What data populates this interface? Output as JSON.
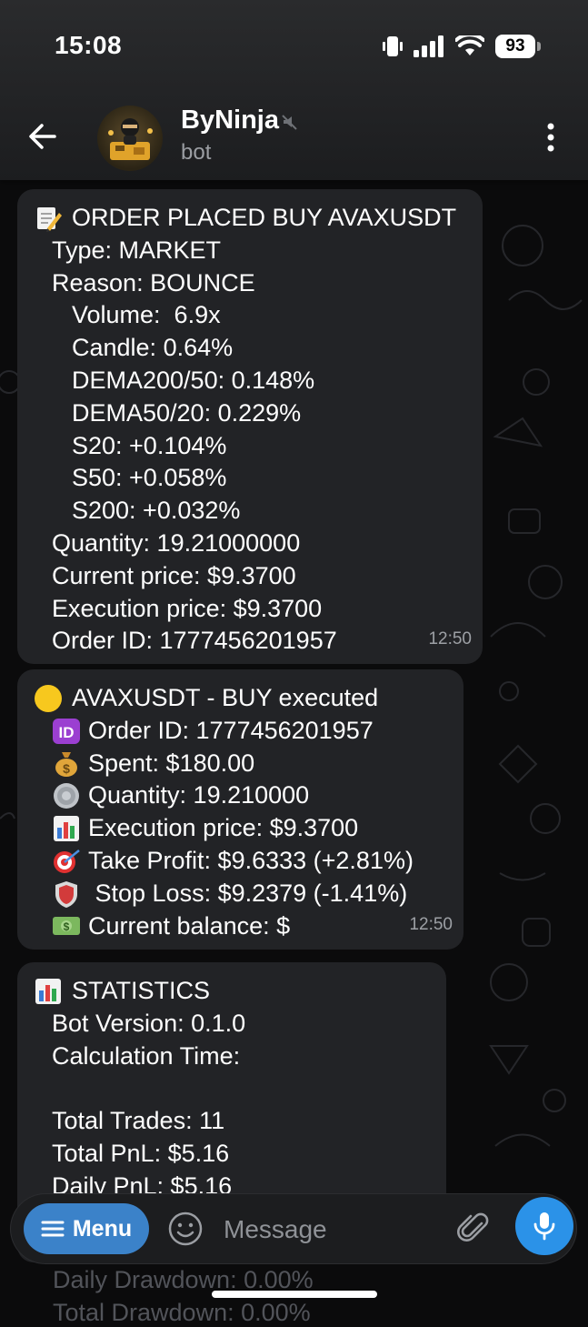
{
  "status_bar": {
    "time": "15:08",
    "battery": "93"
  },
  "header": {
    "title": "ByNinja",
    "subtitle": "bot"
  },
  "messages": [
    {
      "lines": [
        "ORDER PLACED BUY AVAXUSDT",
        "Type: MARKET",
        "Reason: BOUNCE",
        "Volume:  6.9x",
        "Candle: 0.64%",
        "DEMA200/50: 0.148%",
        "DEMA50/20: 0.229%",
        "S20: +0.104%",
        "S50: +0.058%",
        "S200: +0.032%",
        "Quantity: 19.21000000",
        "Current price: $9.3700",
        "Execution price: $9.3700",
        "Order ID: 1777456201957"
      ],
      "time": "12:50"
    },
    {
      "lines": [
        "AVAXUSDT - BUY executed",
        "Order ID: 1777456201957",
        "Spent: $180.00",
        "Quantity: 19.210000",
        "Execution price: $9.3700",
        "Take Profit: $9.6333 (+2.81%)",
        " Stop Loss: $9.2379 (-1.41%)",
        "Current balance: $"
      ],
      "time": "12:50"
    },
    {
      "lines": [
        "STATISTICS",
        "Bot Version: 0.1.0",
        "Calculation Time:",
        "",
        "Total Trades: 11",
        "Total PnL: $5.16",
        "Daily PnL: $5.16"
      ]
    }
  ],
  "below_input": [
    "Daily Drawdown: 0.00%",
    "Total Drawdown: 0.00%"
  ],
  "input_bar": {
    "menu_label": "Menu",
    "placeholder": "Message"
  },
  "colors": {
    "accent": "#3b82c9",
    "mic": "#2b92e8",
    "bubble": "#222326"
  }
}
